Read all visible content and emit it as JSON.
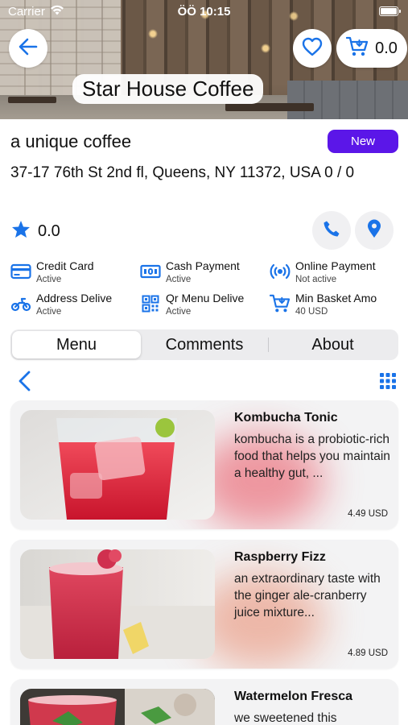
{
  "status_bar": {
    "carrier": "Carrier",
    "time": "ÖÖ 10:15"
  },
  "header": {
    "store_name": "Star House Coffee",
    "cart_amount": "0.0"
  },
  "store": {
    "tagline": "a unique coffee",
    "badge": "New",
    "address": "37-17 76th St 2nd fl, Queens, NY 11372, USA 0 / 0",
    "rating": "0.0"
  },
  "features": [
    {
      "icon": "credit-card-icon",
      "title": "Credit Card",
      "status": "Active"
    },
    {
      "icon": "cash-icon",
      "title": "Cash Payment",
      "status": "Active"
    },
    {
      "icon": "wireless-icon",
      "title": "Online Payment",
      "status": "Not active"
    },
    {
      "icon": "scooter-icon",
      "title": "Address Delive",
      "status": "Active"
    },
    {
      "icon": "qr-code-icon",
      "title": "Qr Menu Delive",
      "status": "Active"
    },
    {
      "icon": "cart-icon",
      "title": "Min Basket Amo",
      "status": "40 USD"
    }
  ],
  "tabs": [
    {
      "label": "Menu",
      "active": true
    },
    {
      "label": "Comments",
      "active": false
    },
    {
      "label": "About",
      "active": false
    }
  ],
  "products": [
    {
      "name": "Kombucha Tonic",
      "description": "kombucha is a probiotic-rich food that helps you maintain a healthy gut, ...",
      "price": "4.49 USD"
    },
    {
      "name": "Raspberry Fizz",
      "description": "an extraordinary taste with the ginger ale-cranberry juice mixture...",
      "price": "4.89 USD"
    },
    {
      "name": "Watermelon Fresca",
      "description": "we sweetened this",
      "price": ""
    }
  ],
  "colors": {
    "accent": "#1a73e8",
    "badge": "#5b16e8"
  }
}
